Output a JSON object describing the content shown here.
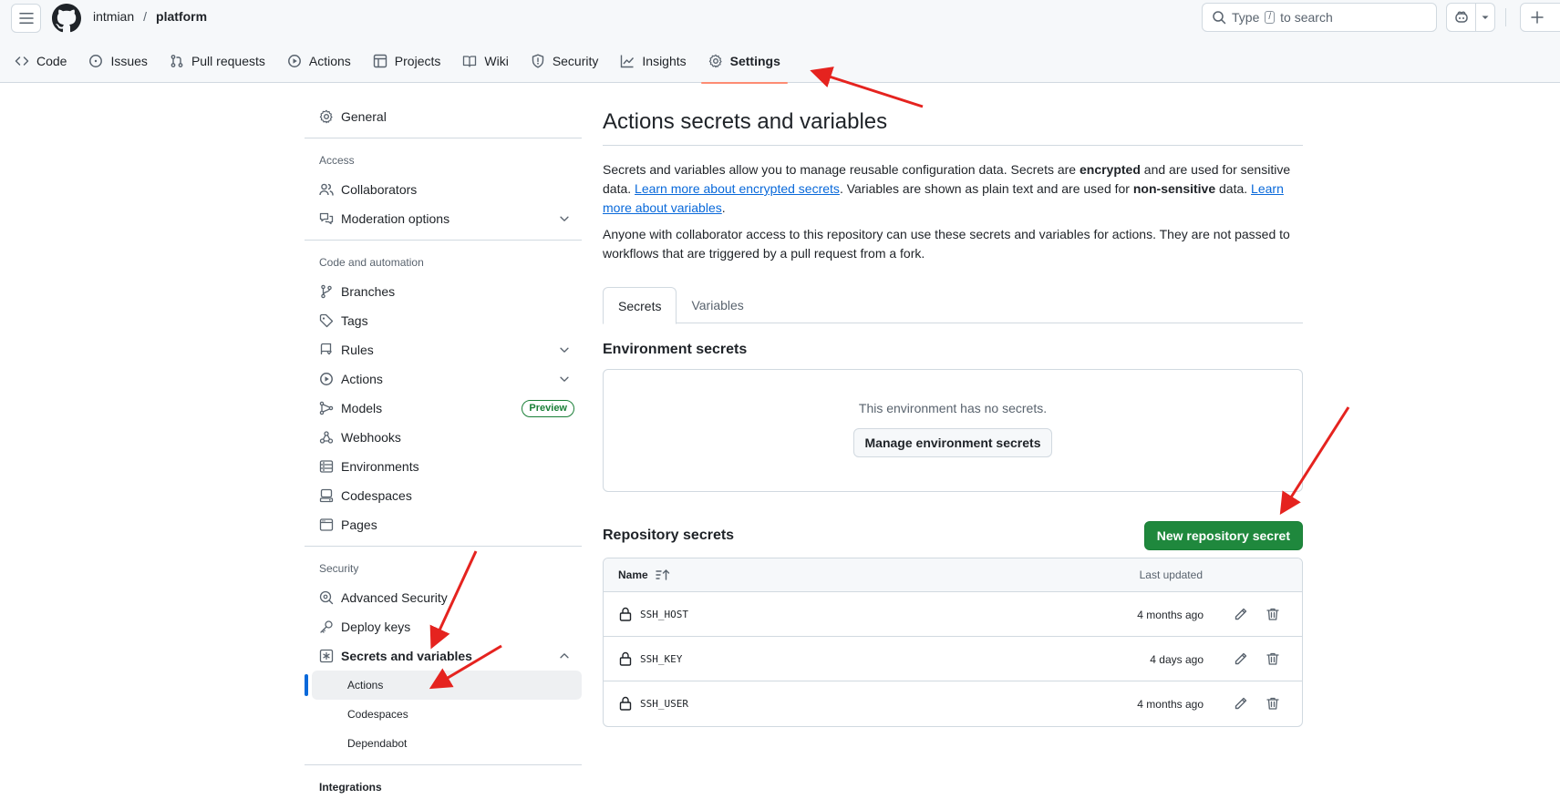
{
  "header": {
    "owner": "intmian",
    "separator": "/",
    "repo": "platform",
    "search_prefix": "Type",
    "search_key": "/",
    "search_suffix": "to search"
  },
  "repo_tabs": [
    {
      "label": "Code",
      "icon": "code-icon"
    },
    {
      "label": "Issues",
      "icon": "issue-icon"
    },
    {
      "label": "Pull requests",
      "icon": "pull-request-icon"
    },
    {
      "label": "Actions",
      "icon": "play-icon"
    },
    {
      "label": "Projects",
      "icon": "table-icon"
    },
    {
      "label": "Wiki",
      "icon": "book-icon"
    },
    {
      "label": "Security",
      "icon": "shield-icon"
    },
    {
      "label": "Insights",
      "icon": "graph-icon"
    },
    {
      "label": "Settings",
      "icon": "gear-icon",
      "active": true
    }
  ],
  "sidebar": {
    "general": "General",
    "access_heading": "Access",
    "collaborators": "Collaborators",
    "moderation": "Moderation options",
    "code_heading": "Code and automation",
    "branches": "Branches",
    "tags": "Tags",
    "rules": "Rules",
    "actions": "Actions",
    "models": "Models",
    "models_badge": "Preview",
    "webhooks": "Webhooks",
    "environments": "Environments",
    "codespaces": "Codespaces",
    "pages": "Pages",
    "security_heading": "Security",
    "advanced_security": "Advanced Security",
    "deploy_keys": "Deploy keys",
    "secrets_and_variables": "Secrets and variables",
    "sub_actions": "Actions",
    "sub_codespaces": "Codespaces",
    "sub_dependabot": "Dependabot",
    "integrations_heading": "Integrations"
  },
  "main": {
    "title": "Actions secrets and variables",
    "desc_part1": "Secrets and variables allow you to manage reusable configuration data. Secrets are ",
    "desc_bold1": "encrypted",
    "desc_part2": " and are used for sensitive data. ",
    "desc_link1": "Learn more about encrypted secrets",
    "desc_part3": ". Variables are shown as plain text and are used for ",
    "desc_bold2": "non-sensitive",
    "desc_part4": " data. ",
    "desc_link2": "Learn more about variables",
    "desc_part5": ".",
    "desc2": "Anyone with collaborator access to this repository can use these secrets and variables for actions. They are not passed to workflows that are triggered by a pull request from a fork.",
    "tab_secrets": "Secrets",
    "tab_variables": "Variables",
    "env_title": "Environment secrets",
    "env_empty": "This environment has no secrets.",
    "env_button": "Manage environment secrets",
    "repo_title": "Repository secrets",
    "new_button": "New repository secret",
    "col_name": "Name",
    "col_updated": "Last updated",
    "secrets": [
      {
        "name": "SSH_HOST",
        "updated": "4 months ago"
      },
      {
        "name": "SSH_KEY",
        "updated": "4 days ago"
      },
      {
        "name": "SSH_USER",
        "updated": "4 months ago"
      }
    ]
  },
  "colors": {
    "primary_button": "#1f883d",
    "active_tab_underline": "#fd8c73",
    "link": "#0969da",
    "annotation_arrow": "#e5231f"
  }
}
